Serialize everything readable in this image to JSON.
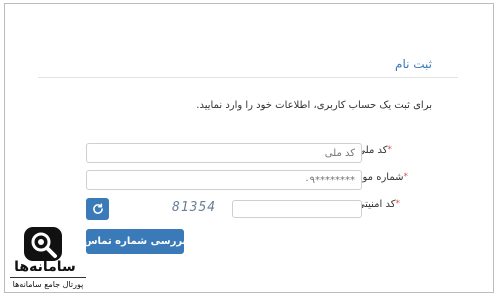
{
  "form": {
    "title": "ثبت نام",
    "description": "برای ثبت یک حساب کاربری، اطلاعات خود را وارد نمایید.",
    "required_mark": "*",
    "national_code": {
      "label": "کد ملی",
      "placeholder": "کد ملی",
      "value": ""
    },
    "mobile": {
      "label": "شماره موبایل",
      "placeholder": "********۰۹",
      "value": ""
    },
    "security_code": {
      "label": "کد امنیتی",
      "value": "",
      "captcha_text": "81354"
    },
    "refresh_icon": "refresh-icon",
    "submit_label": "بررسی شماره تماس"
  },
  "watermark": {
    "name": "سامانه‌ها",
    "tagline": "پورتال جامع سامانه‌ها"
  },
  "colors": {
    "accent": "#3a7ab8",
    "required": "#d9534f"
  }
}
